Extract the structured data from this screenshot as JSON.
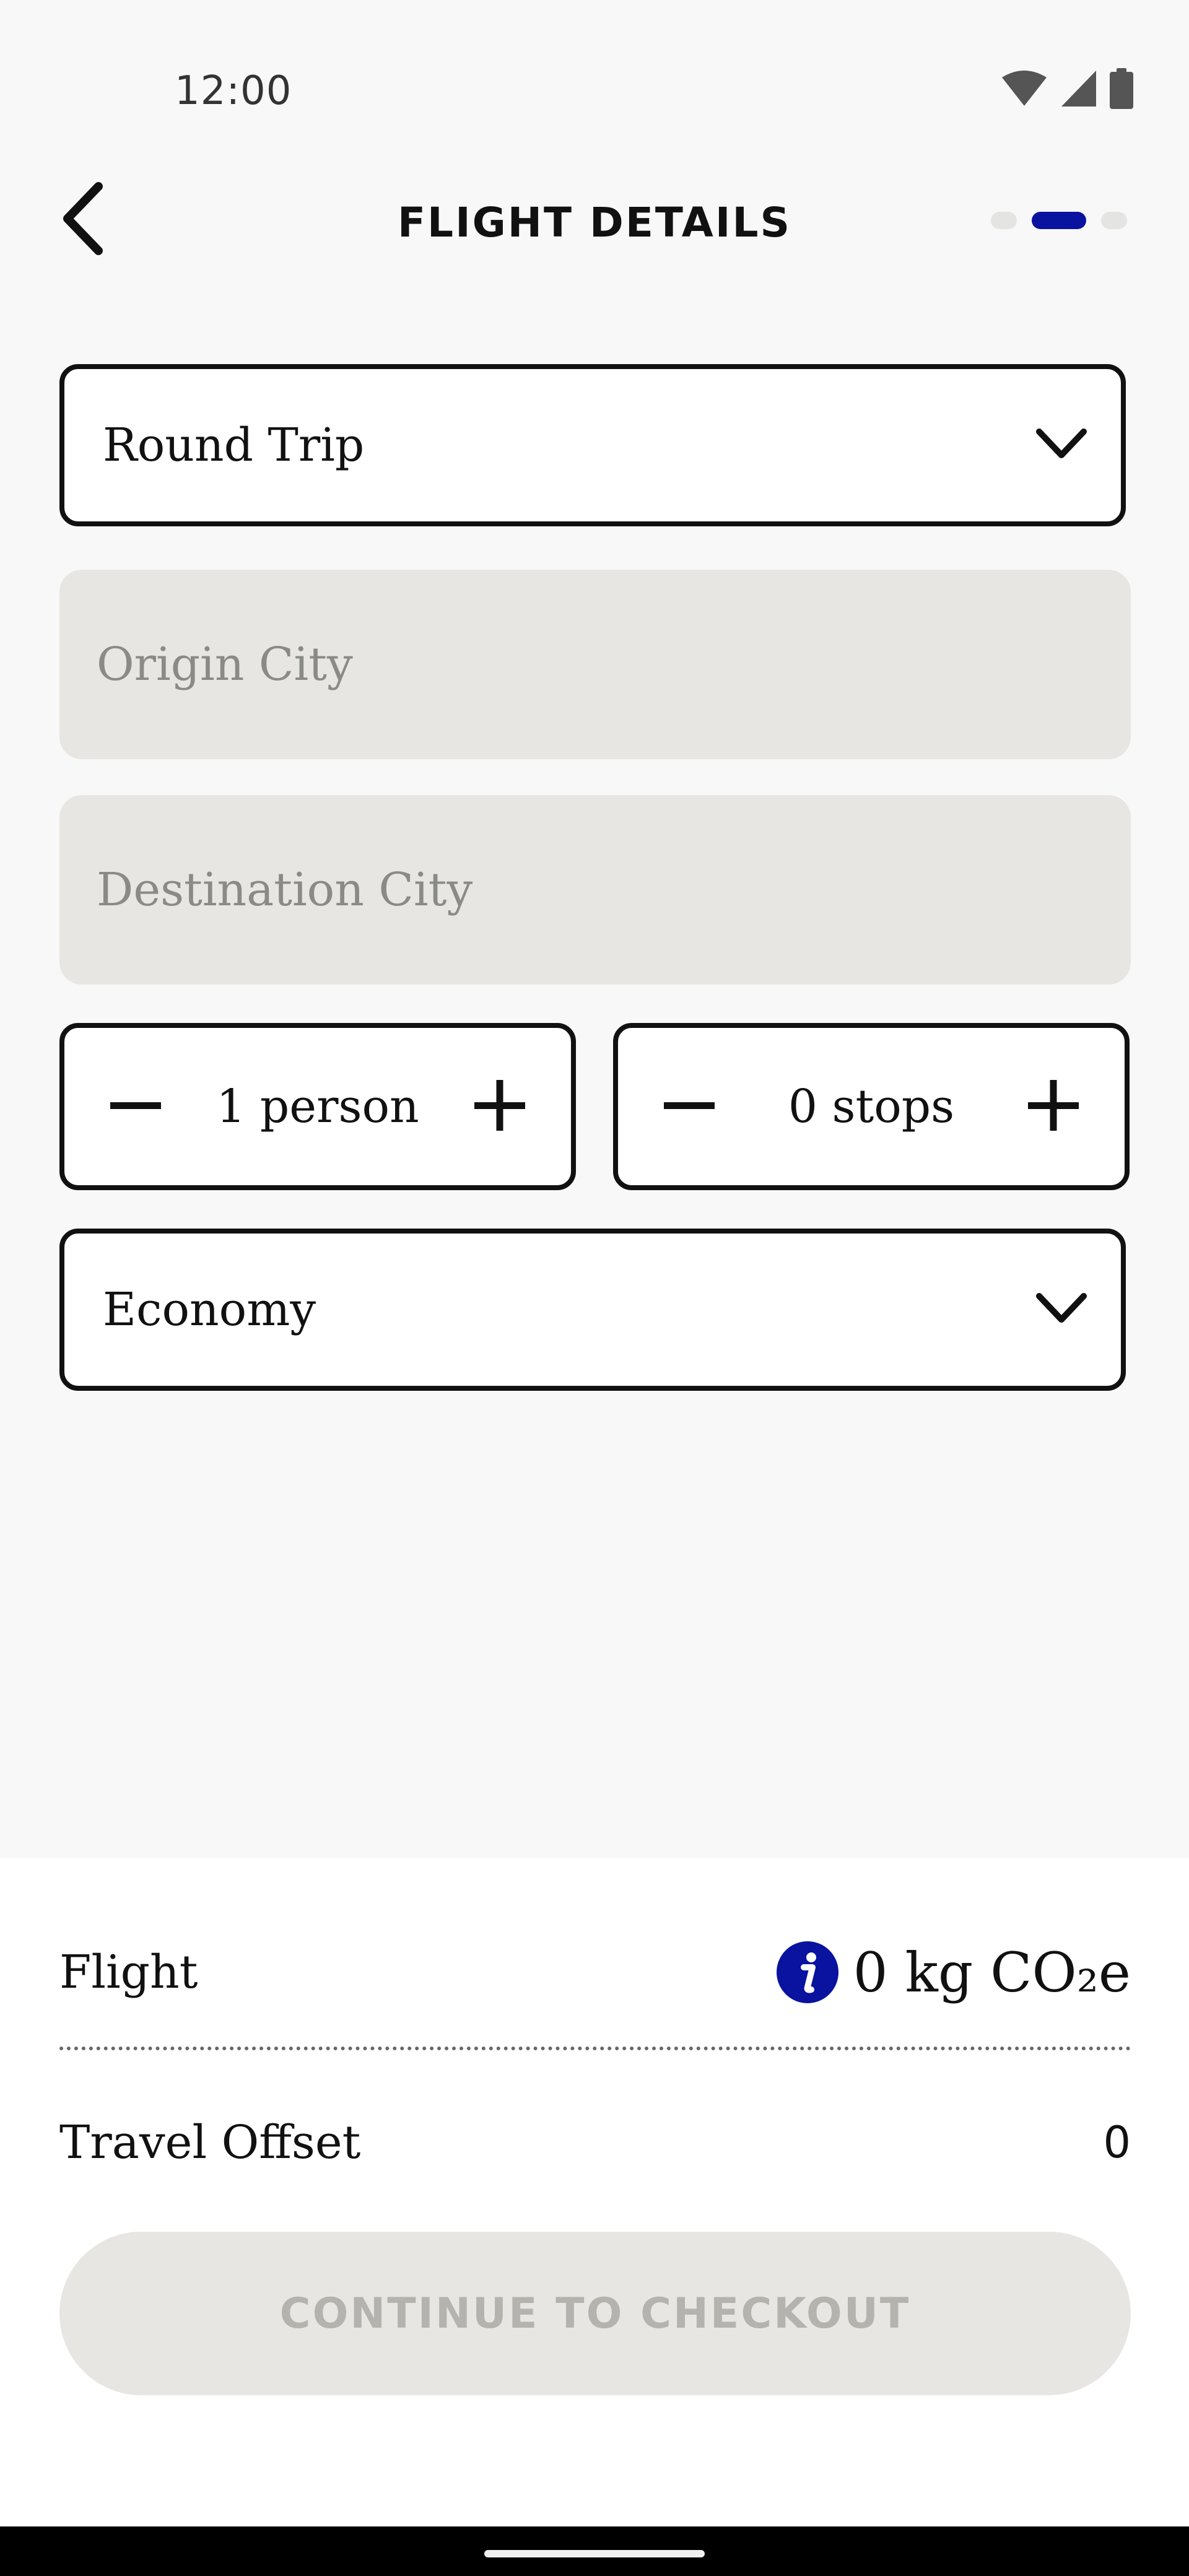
{
  "status_bar": {
    "time": "12:00",
    "icons": [
      "wifi-icon",
      "cellular-signal-icon",
      "battery-icon"
    ]
  },
  "header": {
    "back_icon": "chevron-left-icon",
    "title": "FLIGHT DETAILS",
    "steps": {
      "total": 3,
      "active_index": 1
    }
  },
  "form": {
    "trip_type": {
      "value": "Round Trip",
      "icon": "chevron-down-icon"
    },
    "origin": {
      "placeholder": "Origin City",
      "value": ""
    },
    "destination": {
      "placeholder": "Destination City",
      "value": ""
    },
    "passengers": {
      "value": "1 person",
      "decrement_icon": "minus-icon",
      "increment_icon": "plus-icon"
    },
    "stops": {
      "value": "0 stops",
      "decrement_icon": "minus-icon",
      "increment_icon": "plus-icon"
    },
    "cabin_class": {
      "value": "Economy",
      "icon": "chevron-down-icon"
    }
  },
  "summary": {
    "flight_label": "Flight",
    "info_icon": "info-icon",
    "emissions_value": "0 kg CO₂e",
    "offset_label": "Travel Offset",
    "offset_value": "0",
    "checkout_label": "CONTINUE TO CHECKOUT"
  },
  "colors": {
    "accent": "#0a12a0",
    "background": "#f8f8f8",
    "input_fill": "#e7e6e3",
    "disabled_text": "#b4b3ae"
  }
}
